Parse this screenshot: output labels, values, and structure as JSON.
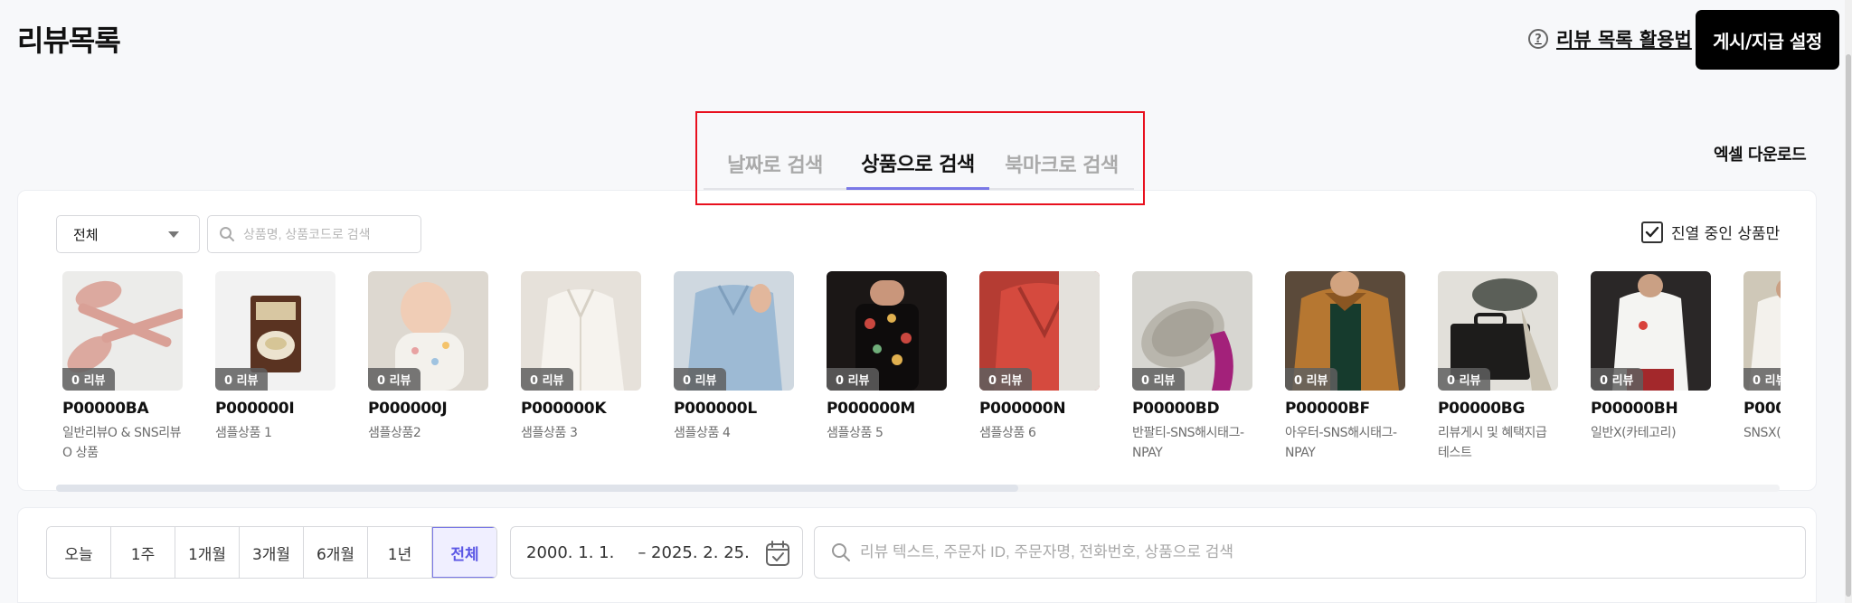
{
  "header": {
    "title": "리뷰목록",
    "guide_link": "리뷰 목록 활용법",
    "help_icon": "?",
    "primary_button": "게시/지급 설정"
  },
  "tabs": [
    {
      "label": "날짜로 검색",
      "active": false
    },
    {
      "label": "상품으로 검색",
      "active": true
    },
    {
      "label": "북마크로 검색",
      "active": false
    }
  ],
  "excel_download": "엑셀 다운로드",
  "product_filter": {
    "select_value": "전체",
    "search_placeholder": "상품명, 상품코드로 검색",
    "checkbox_label": "진열 중인 상품만",
    "checkbox_checked": true
  },
  "products": [
    {
      "code": "P00000BA",
      "name": "일반리뷰O & SNS리뷰O 상품",
      "reviews": "0 리뷰"
    },
    {
      "code": "P000000I",
      "name": "샘플상품 1",
      "reviews": "0 리뷰"
    },
    {
      "code": "P000000J",
      "name": "샘플상품2",
      "reviews": "0 리뷰"
    },
    {
      "code": "P000000K",
      "name": "샘플상품 3",
      "reviews": "0 리뷰"
    },
    {
      "code": "P000000L",
      "name": "샘플상품 4",
      "reviews": "0 리뷰"
    },
    {
      "code": "P000000M",
      "name": "샘플상품 5",
      "reviews": "0 리뷰"
    },
    {
      "code": "P000000N",
      "name": "샘플상품 6",
      "reviews": "0 리뷰"
    },
    {
      "code": "P00000BD",
      "name": "반팔티-SNS해시태그-NPAY",
      "reviews": "0 리뷰"
    },
    {
      "code": "P00000BF",
      "name": "아우터-SNS해시태그-NPAY",
      "reviews": "0 리뷰"
    },
    {
      "code": "P00000BG",
      "name": "리뷰게시 및 혜택지급 테스트",
      "reviews": "0 리뷰"
    },
    {
      "code": "P00000BH",
      "name": "일반X(카테고리)",
      "reviews": "0 리뷰"
    },
    {
      "code": "P000",
      "name": "SNSX(",
      "reviews": "0 리뷰"
    }
  ],
  "period_buttons": [
    "오늘",
    "1주",
    "1개월",
    "3개월",
    "6개월",
    "1년",
    "전체"
  ],
  "active_period": "전체",
  "date_range": {
    "start": "2000. 1. 1.",
    "end": "– 2025. 2. 25."
  },
  "review_search_placeholder": "리뷰 텍스트, 주문자 ID, 주문자명, 전화번호, 상품으로 검색",
  "colors": {
    "accent": "#7a78e6",
    "highlight_box": "#e8101e",
    "primary_button": "#000000"
  },
  "icons": [
    "help-icon",
    "caret-down-icon",
    "search-icon",
    "check-icon",
    "calendar-icon"
  ]
}
